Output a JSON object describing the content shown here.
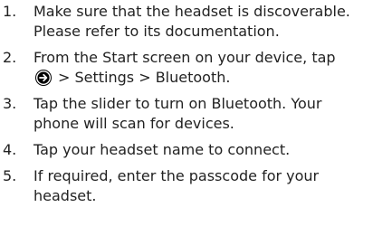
{
  "steps": [
    {
      "number": "1.",
      "lines": [
        "Make sure that the headset is discoverable.",
        "Please refer to its documentation."
      ]
    },
    {
      "number": "2.",
      "lines": [
        "From the Start screen on your device, tap",
        "> Settings > Bluetooth."
      ],
      "icon": "arrow-circle-icon"
    },
    {
      "number": "3.",
      "lines": [
        "Tap the slider to turn on Bluetooth. Your",
        "phone will scan for devices."
      ]
    },
    {
      "number": "4.",
      "lines": [
        "Tap your headset name to connect."
      ]
    },
    {
      "number": "5.",
      "lines": [
        "If required, enter the passcode for your",
        "headset."
      ]
    }
  ]
}
